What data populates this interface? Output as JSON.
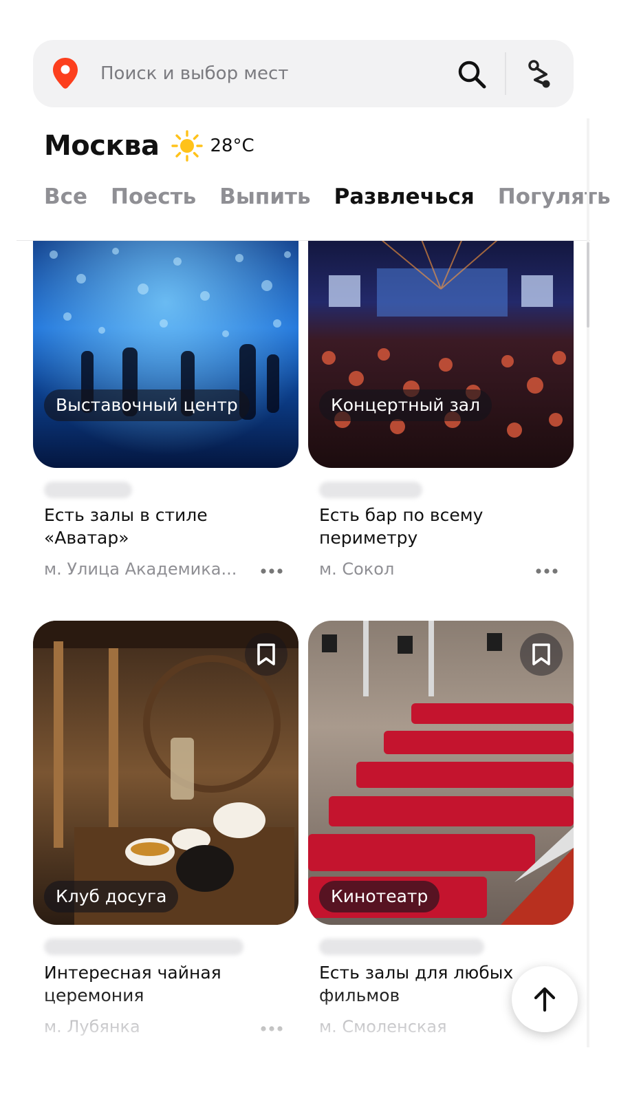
{
  "search": {
    "placeholder": "Поиск и выбор мест"
  },
  "icons": {
    "pin": "map-pin-icon",
    "search": "search-icon",
    "route": "route-icon",
    "weather": "sun-icon",
    "bookmark": "bookmark-icon",
    "more": "more-icon",
    "scroll_top": "arrow-up-icon"
  },
  "colors": {
    "accent": "#fc3f1d",
    "text": "#111111",
    "muted": "#8f8f94",
    "search_bg": "#f2f2f3"
  },
  "city": {
    "name": "Москва",
    "temperature": "28°C"
  },
  "tabs": [
    {
      "label": "Все",
      "active": false
    },
    {
      "label": "Поесть",
      "active": false
    },
    {
      "label": "Выпить",
      "active": false
    },
    {
      "label": "Развлечься",
      "active": true
    },
    {
      "label": "Погулять",
      "active": false
    }
  ],
  "cards": [
    {
      "category": "Выставочный центр",
      "description": "Есть залы в стиле «Аватар»",
      "metro": "м. Улица Академика...",
      "bookmark": false
    },
    {
      "category": "Концертный зал",
      "description": "Есть бар по всему периметру",
      "metro": "м. Сокол",
      "bookmark": false
    },
    {
      "category": "Клуб досуга",
      "description": "Интересная чайная церемония",
      "metro": "м. Лубянка",
      "bookmark": true
    },
    {
      "category": "Кинотеатр",
      "description": "Есть залы для любых фильмов",
      "metro": "м. Смоленская",
      "bookmark": true
    }
  ]
}
